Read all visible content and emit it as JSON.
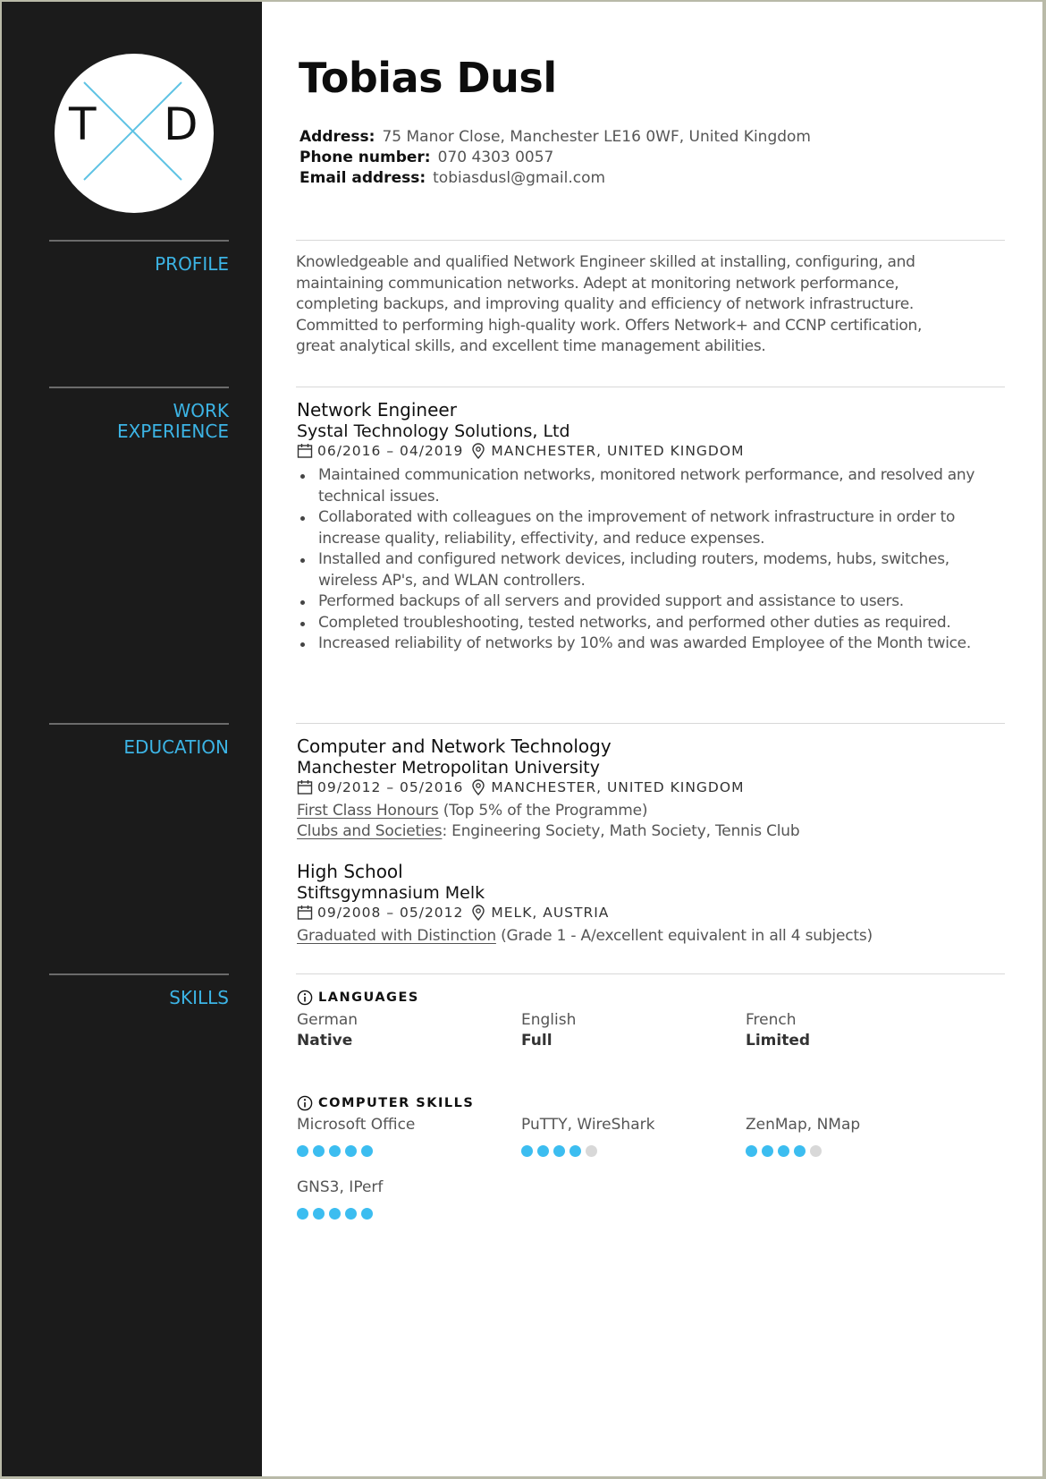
{
  "monogram": {
    "left": "T",
    "right": "D",
    "cross_color": "#5fc3e4"
  },
  "header": {
    "name": "Tobias Dusl",
    "contact": [
      {
        "label": "Address:",
        "value": "75 Manor Close, Manchester LE16 0WF, United Kingdom"
      },
      {
        "label": "Phone number:",
        "value": "070 4303 0057"
      },
      {
        "label": "Email address:",
        "value": "tobiasdusl@gmail.com"
      }
    ]
  },
  "colors": {
    "accent": "#3cb4e5",
    "sidebar": "#1b1b1b",
    "dot_on": "#3cbdf0",
    "dot_off": "#d8d8d8"
  },
  "sections": {
    "profile": "PROFILE",
    "work_1": "WORK",
    "work_2": "EXPERIENCE",
    "education": "EDUCATION",
    "skills": "SKILLS"
  },
  "profile": {
    "lines": [
      "Knowledgeable and qualified Network Engineer skilled at installing, configuring, and",
      "maintaining communication networks. Adept at monitoring network performance,",
      "completing backups, and improving quality and efficiency of network infrastructure.",
      "Committed to performing high-quality work. Offers Network+ and CCNP certification,",
      "great analytical skills, and excellent time management abilities."
    ]
  },
  "work": [
    {
      "title": "Network Engineer",
      "company": "Systal Technology Solutions, Ltd",
      "dates": "06/2016 – 04/2019",
      "location": "MANCHESTER, UNITED KINGDOM",
      "bullets": [
        "Maintained communication networks, monitored network performance, and resolved any technical issues.",
        "Collaborated with colleagues on the improvement of network infrastructure in order to increase quality, reliability, effectivity, and reduce expenses.",
        "Installed and configured network devices, including routers, modems, hubs, switches, wireless AP's, and WLAN controllers.",
        "Performed backups of all servers and provided support and assistance to users.",
        "Completed troubleshooting, tested networks, and performed other duties as required.",
        "Increased reliability of networks by 10% and was awarded Employee of the Month twice."
      ]
    }
  ],
  "education": [
    {
      "degree": "Computer and Network Technology",
      "school": "Manchester Metropolitan University",
      "dates": "09/2012 – 05/2016",
      "location": "MANCHESTER, UNITED KINGDOM",
      "notes": [
        {
          "link": "First Class Honours",
          "text": " (Top 5% of the Programme)"
        },
        {
          "link": "Clubs and Societies",
          "text": ": Engineering Society, Math Society, Tennis Club"
        }
      ]
    },
    {
      "degree": "High School",
      "school": "Stiftsgymnasium Melk",
      "dates": "09/2008 – 05/2012",
      "location": "MELK, AUSTRIA",
      "notes": [
        {
          "link": "Graduated with Distinction",
          "text": " (Grade 1 - A/excellent equivalent in all 4 subjects)"
        }
      ]
    }
  ],
  "skills": {
    "languages_title": "LANGUAGES",
    "languages": [
      {
        "name": "German",
        "level": "Native"
      },
      {
        "name": "English",
        "level": "Full"
      },
      {
        "name": "French",
        "level": "Limited"
      }
    ],
    "computer_title": "COMPUTER SKILLS",
    "computer": [
      {
        "name": "Microsoft Office",
        "rating": 5,
        "max": 5
      },
      {
        "name": "PuTTY, WireShark",
        "rating": 4,
        "max": 5
      },
      {
        "name": "ZenMap, NMap",
        "rating": 4,
        "max": 5
      },
      {
        "name": "GNS3, IPerf",
        "rating": 5,
        "max": 5
      }
    ]
  }
}
